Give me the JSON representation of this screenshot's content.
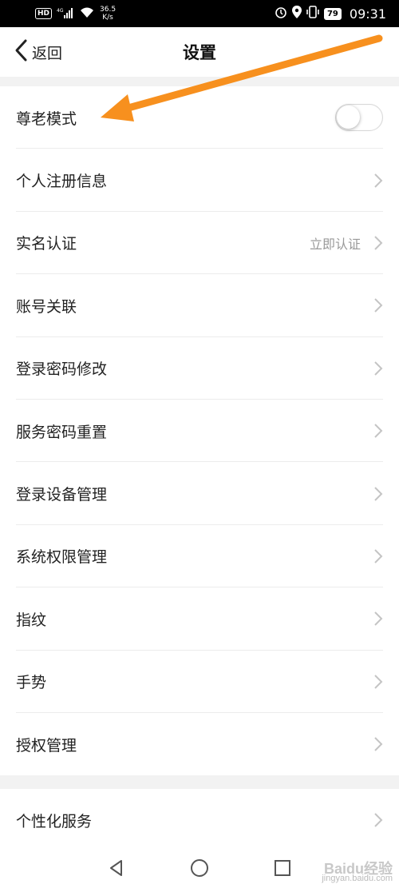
{
  "status_bar": {
    "hd": "HD",
    "network": "4G",
    "speed_value": "36.5",
    "speed_unit": "K/s",
    "battery": "79",
    "time": "09:31"
  },
  "nav": {
    "back_label": "返回",
    "title": "设置"
  },
  "settings_group_1": [
    {
      "label": "尊老模式",
      "type": "toggle",
      "toggle_on": false
    },
    {
      "label": "个人注册信息",
      "type": "link"
    },
    {
      "label": "实名认证",
      "type": "link",
      "hint": "立即认证"
    },
    {
      "label": "账号关联",
      "type": "link"
    },
    {
      "label": "登录密码修改",
      "type": "link"
    },
    {
      "label": "服务密码重置",
      "type": "link"
    },
    {
      "label": "登录设备管理",
      "type": "link"
    },
    {
      "label": "系统权限管理",
      "type": "link"
    },
    {
      "label": "指纹",
      "type": "link"
    },
    {
      "label": "手势",
      "type": "link"
    },
    {
      "label": "授权管理",
      "type": "link"
    }
  ],
  "settings_group_2": [
    {
      "label": "个性化服务",
      "type": "link"
    }
  ],
  "colors": {
    "annotation_arrow": "#f7901e",
    "chevron": "#c4c4c4"
  },
  "watermark": {
    "brand": "Baidu经验",
    "url": "jingyan.baidu.com"
  }
}
